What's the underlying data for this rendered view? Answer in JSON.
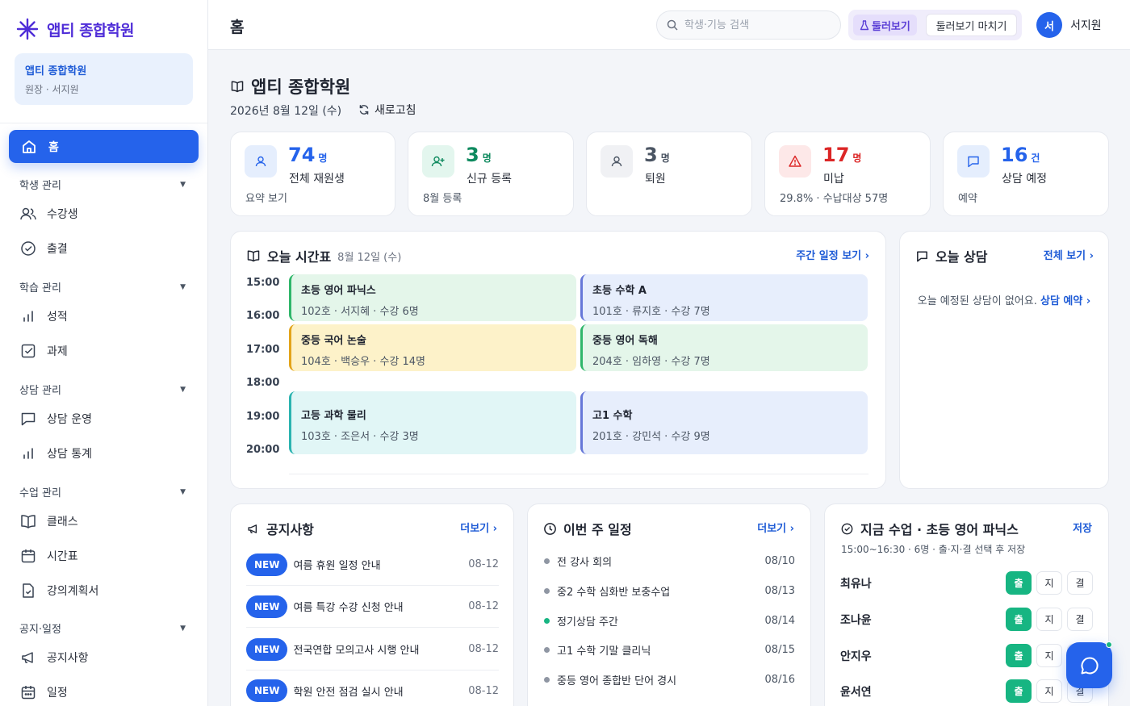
{
  "brand": {
    "name": "앱티 종합학원"
  },
  "org": {
    "name": "앱티 종합학원",
    "role": "원장 · 서지원"
  },
  "sidebar": {
    "home": "홈",
    "sections": [
      {
        "title": "학생 관리",
        "items": [
          "수강생",
          "출결"
        ]
      },
      {
        "title": "학습 관리",
        "items": [
          "성적",
          "과제"
        ]
      },
      {
        "title": "상담 관리",
        "items": [
          "상담 운영",
          "상담 통계"
        ]
      },
      {
        "title": "수업 관리",
        "items": [
          "클래스",
          "시간표",
          "강의계획서"
        ]
      },
      {
        "title": "공지·일정",
        "items": [
          "공지사항",
          "일정"
        ]
      }
    ]
  },
  "header": {
    "title": "홈",
    "search_placeholder": "학생·기능 검색",
    "preview_label": "둘러보기",
    "preview_end_label": "둘러보기 마치기",
    "user_initial": "서",
    "user_name": "서지원"
  },
  "main": {
    "title": "앱티 종합학원",
    "date": "2026년 8월 12일 (수)",
    "refresh_label": "새로고침"
  },
  "stats": [
    {
      "value": "74",
      "unit": "명",
      "label": "전체 재원생",
      "sub": "요약 보기",
      "color": "#2563eb"
    },
    {
      "value": "3",
      "unit": "명",
      "label": "신규 등록",
      "sub": "8월 등록",
      "color": "#0f8a5f"
    },
    {
      "value": "3",
      "unit": "명",
      "label": "퇴원",
      "sub": "",
      "color": "#4b5563"
    },
    {
      "value": "17",
      "unit": "명",
      "label": "미납",
      "sub": "29.8% · 수납대상 57명",
      "color": "#dc2626"
    },
    {
      "value": "16",
      "unit": "건",
      "label": "상담 예정",
      "sub": "예약",
      "color": "#2563eb"
    }
  ],
  "timetable": {
    "title": "오늘 시간표",
    "date": "8월 12일 (수)",
    "link": "주간 일정 보기 ›",
    "times": [
      "15:00",
      "16:00",
      "17:00",
      "18:00",
      "19:00",
      "20:00"
    ],
    "events": [
      {
        "title": "초등 영어 파닉스",
        "sub": "102호 · 서지혜 · 수강 6명"
      },
      {
        "title": "초등 수학 A",
        "sub": "101호 · 류지호 · 수강 7명"
      },
      {
        "title": "중등 국어 논술",
        "sub": "104호 · 백승우 · 수강 14명"
      },
      {
        "title": "중등 영어 독해",
        "sub": "204호 · 임하영 · 수강 7명"
      },
      {
        "title": "고등 과학 물리",
        "sub": "103호 · 조은서 · 수강 3명"
      },
      {
        "title": "고1 수학",
        "sub": "201호 · 강민석 · 수강 9명"
      }
    ]
  },
  "consult": {
    "title": "오늘 상담",
    "link": "전체 보기 ›",
    "empty": "오늘 예정된 상담이 없어요.",
    "empty_link": "상담 예약 ›"
  },
  "notices": {
    "title": "공지사항",
    "link": "더보기 ›",
    "badge": "NEW",
    "items": [
      {
        "title": "여름 휴원 일정 안내",
        "date": "08-12"
      },
      {
        "title": "여름 특강 수강 신청 안내",
        "date": "08-12"
      },
      {
        "title": "전국연합 모의고사 시행 안내",
        "date": "08-12"
      },
      {
        "title": "학원 안전 점검 실시 안내",
        "date": "08-12"
      }
    ]
  },
  "schedule": {
    "title": "이번 주 일정",
    "link": "더보기 ›",
    "items": [
      {
        "title": "전 강사 회의",
        "date": "08/10"
      },
      {
        "title": "중2 수학 심화반 보충수업",
        "date": "08/13"
      },
      {
        "title": "정기상담 주간",
        "date": "08/14"
      },
      {
        "title": "고1 수학 기말 클리닉",
        "date": "08/15"
      },
      {
        "title": "중등 영어 종합반 단어 경시",
        "date": "08/16"
      }
    ]
  },
  "attendance": {
    "title": "지금 수업 · 초등 영어 파닉스",
    "save": "저장",
    "sub": "15:00~16:30 · 6명 · 출·지·결 선택 후 저장",
    "btn_present": "출",
    "btn_late": "지",
    "btn_absent": "결",
    "students": [
      "최유나",
      "조나윤",
      "안지우",
      "윤서연"
    ]
  },
  "colors": {
    "accent": "#2563eb",
    "brand": "#4f2dd8",
    "present": "#17b582"
  }
}
